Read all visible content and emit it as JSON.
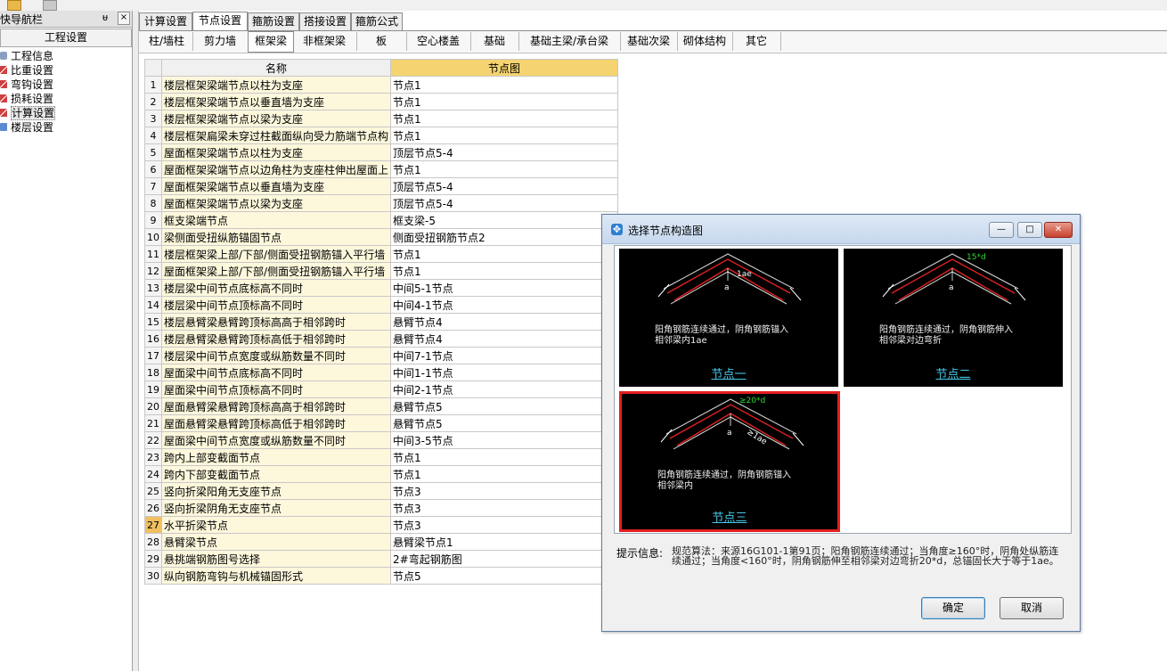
{
  "nav": {
    "title": "快导航栏",
    "pin": "ᵾ",
    "close": "×",
    "section": "工程设置",
    "items": [
      {
        "label": "工程信息",
        "icon": "gear-icon"
      },
      {
        "label": "比重设置",
        "icon": "ruler-icon"
      },
      {
        "label": "弯钩设置",
        "icon": "ruler-icon"
      },
      {
        "label": "损耗设置",
        "icon": "ruler-icon"
      },
      {
        "label": "计算设置",
        "icon": "ruler-icon"
      },
      {
        "label": "楼层设置",
        "icon": "layers-icon"
      }
    ],
    "selected_index": 4
  },
  "tabs": [
    {
      "label": "计算设置"
    },
    {
      "label": "节点设置"
    },
    {
      "label": "箍筋设置"
    },
    {
      "label": "搭接设置"
    },
    {
      "label": "箍筋公式"
    }
  ],
  "subtabs": [
    {
      "label": "柱/墙柱"
    },
    {
      "label": "剪力墙"
    },
    {
      "label": "框架梁"
    },
    {
      "label": "非框架梁"
    },
    {
      "label": "板"
    },
    {
      "label": "空心楼盖"
    },
    {
      "label": "基础"
    },
    {
      "label": "基础主梁/承台梁"
    },
    {
      "label": "基础次梁"
    },
    {
      "label": "砌体结构"
    },
    {
      "label": "其它"
    }
  ],
  "table": {
    "headers": {
      "name": "名称",
      "node": "节点图"
    },
    "selected_row": 27,
    "rows": [
      {
        "n": "1",
        "name": "楼层框架梁端节点以柱为支座",
        "val": "节点1"
      },
      {
        "n": "2",
        "name": "楼层框架梁端节点以垂直墙为支座",
        "val": "节点1"
      },
      {
        "n": "3",
        "name": "楼层框架梁端节点以梁为支座",
        "val": "节点1"
      },
      {
        "n": "4",
        "name": "楼层框架扁梁未穿过柱截面纵向受力筋端节点构",
        "val": "节点1"
      },
      {
        "n": "5",
        "name": "屋面框架梁端节点以柱为支座",
        "val": "顶层节点5-4"
      },
      {
        "n": "6",
        "name": "屋面框架梁端节点以边角柱为支座柱伸出屋面上",
        "val": "节点1"
      },
      {
        "n": "7",
        "name": "屋面框架梁端节点以垂直墙为支座",
        "val": "顶层节点5-4"
      },
      {
        "n": "8",
        "name": "屋面框架梁端节点以梁为支座",
        "val": "顶层节点5-4"
      },
      {
        "n": "9",
        "name": "框支梁端节点",
        "val": "框支梁-5"
      },
      {
        "n": "10",
        "name": "梁侧面受扭纵筋锚固节点",
        "val": "侧面受扭钢筋节点2"
      },
      {
        "n": "11",
        "name": "楼层框架梁上部/下部/侧面受扭钢筋锚入平行墙",
        "val": "节点1"
      },
      {
        "n": "12",
        "name": "屋面框架梁上部/下部/侧面受扭钢筋锚入平行墙",
        "val": "节点1"
      },
      {
        "n": "13",
        "name": "楼层梁中间节点底标高不同时",
        "val": "中间5-1节点"
      },
      {
        "n": "14",
        "name": "楼层梁中间节点顶标高不同时",
        "val": "中间4-1节点"
      },
      {
        "n": "15",
        "name": "楼层悬臂梁悬臂跨顶标高高于相邻跨时",
        "val": "悬臂节点4"
      },
      {
        "n": "16",
        "name": "楼层悬臂梁悬臂跨顶标高低于相邻跨时",
        "val": "悬臂节点4"
      },
      {
        "n": "17",
        "name": "楼层梁中间节点宽度或纵筋数量不同时",
        "val": "中间7-1节点"
      },
      {
        "n": "18",
        "name": "屋面梁中间节点底标高不同时",
        "val": "中间1-1节点"
      },
      {
        "n": "19",
        "name": "屋面梁中间节点顶标高不同时",
        "val": "中间2-1节点"
      },
      {
        "n": "20",
        "name": "屋面悬臂梁悬臂跨顶标高高于相邻跨时",
        "val": "悬臂节点5"
      },
      {
        "n": "21",
        "name": "屋面悬臂梁悬臂跨顶标高低于相邻跨时",
        "val": "悬臂节点5"
      },
      {
        "n": "22",
        "name": "屋面梁中间节点宽度或纵筋数量不同时",
        "val": "中间3-5节点"
      },
      {
        "n": "23",
        "name": "跨内上部变截面节点",
        "val": "节点1"
      },
      {
        "n": "24",
        "name": "跨内下部变截面节点",
        "val": "节点1"
      },
      {
        "n": "25",
        "name": "竖向折梁阳角无支座节点",
        "val": "节点3"
      },
      {
        "n": "26",
        "name": "竖向折梁阴角无支座节点",
        "val": "节点3"
      },
      {
        "n": "27",
        "name": "水平折梁节点",
        "val": "节点3"
      },
      {
        "n": "28",
        "name": "悬臂梁节点",
        "val": "悬臂梁节点1"
      },
      {
        "n": "29",
        "name": "悬挑端钢筋图号选择",
        "val": "2#弯起钢筋图"
      },
      {
        "n": "30",
        "name": "纵向钢筋弯钩与机械锚固形式",
        "val": "节点5"
      }
    ]
  },
  "dialog": {
    "title": "选择节点构造图",
    "buttons": {
      "min": "—",
      "max": "□",
      "close": "✕"
    },
    "cards": [
      {
        "label": "节点一",
        "caption": "阳角钢筋连续通过，阴角钢筋锚入\n相邻梁内1ae",
        "dim": "1ae",
        "ann": "a"
      },
      {
        "label": "节点二",
        "caption": "阳角钢筋连续通过，阴角钢筋伸入\n相邻梁对边弯折",
        "dim": "15*d",
        "ann": "a"
      },
      {
        "label": "节点三",
        "caption": "阳角钢筋连续通过，阴角钢筋锚入\n相邻梁内",
        "dim": "≥20*d",
        "dim2": "≥1ae",
        "ann": "a"
      }
    ],
    "selected_card": 2,
    "hint_label": "提示信息:",
    "hint_text": "规范算法：来源16G101-1第91页；阳角钢筋连续通过；当角度≥160°时，阴角处纵筋连续通过；当角度<160°时，阴角钢筋伸至相邻梁对边弯折20*d，总锚固长大于等于1ae。",
    "ok": "确定",
    "cancel": "取消"
  },
  "colors": {
    "dim_green": "#33d633",
    "rebar_red": "#e02020",
    "label_cyan": "#48c8e8",
    "selected_border": "#e41e1e"
  }
}
